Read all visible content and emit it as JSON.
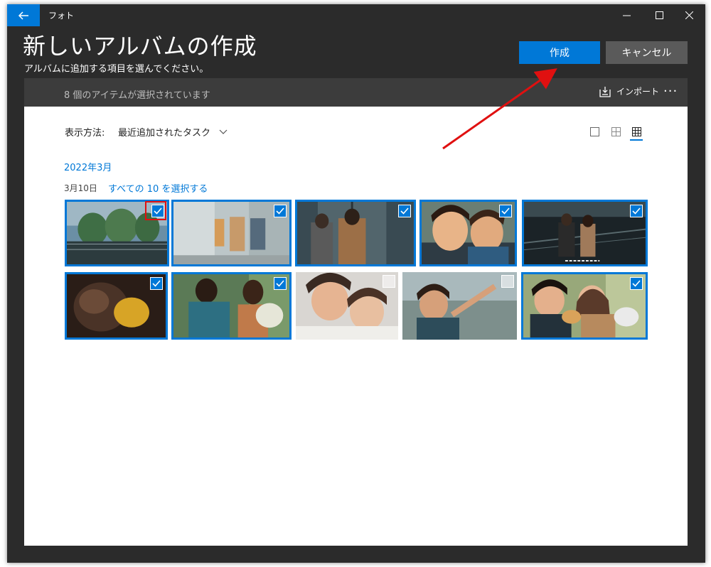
{
  "window": {
    "app_title": "フォト",
    "controls": [
      "minimize",
      "maximize",
      "close"
    ]
  },
  "header": {
    "title": "新しいアルバムの作成",
    "subtitle": "アルバムに追加する項目を選んでください。",
    "create_label": "作成",
    "cancel_label": "キャンセル"
  },
  "toolbar": {
    "selection_text": "8 個のアイテムが選択されています",
    "import_label": "インポート",
    "more_label": "···"
  },
  "view": {
    "label": "表示方法:",
    "value": "最近追加されたタスク",
    "modes": [
      "large",
      "medium",
      "small"
    ],
    "active_mode": "small"
  },
  "group": {
    "month": "2022年3月",
    "day": "3月10日",
    "select_all": "すべての 10 を選択する"
  },
  "photos": [
    {
      "selected": true,
      "scene": "gas-tanks"
    },
    {
      "selected": true,
      "scene": "street-couple"
    },
    {
      "selected": true,
      "scene": "glass-door"
    },
    {
      "selected": true,
      "scene": "smiling-couple"
    },
    {
      "selected": true,
      "scene": "night-station"
    },
    {
      "selected": true,
      "scene": "dark-embrace"
    },
    {
      "selected": true,
      "scene": "bouquet-couple"
    },
    {
      "selected": false,
      "scene": "lying-couple"
    },
    {
      "selected": false,
      "scene": "beach-selfie"
    },
    {
      "selected": true,
      "scene": "eating-couple"
    }
  ],
  "colors": {
    "accent": "#0078d7",
    "window_bg": "#2b2b2b",
    "toolbar_bg": "#3c3c3c",
    "annotation": "#e01010"
  }
}
